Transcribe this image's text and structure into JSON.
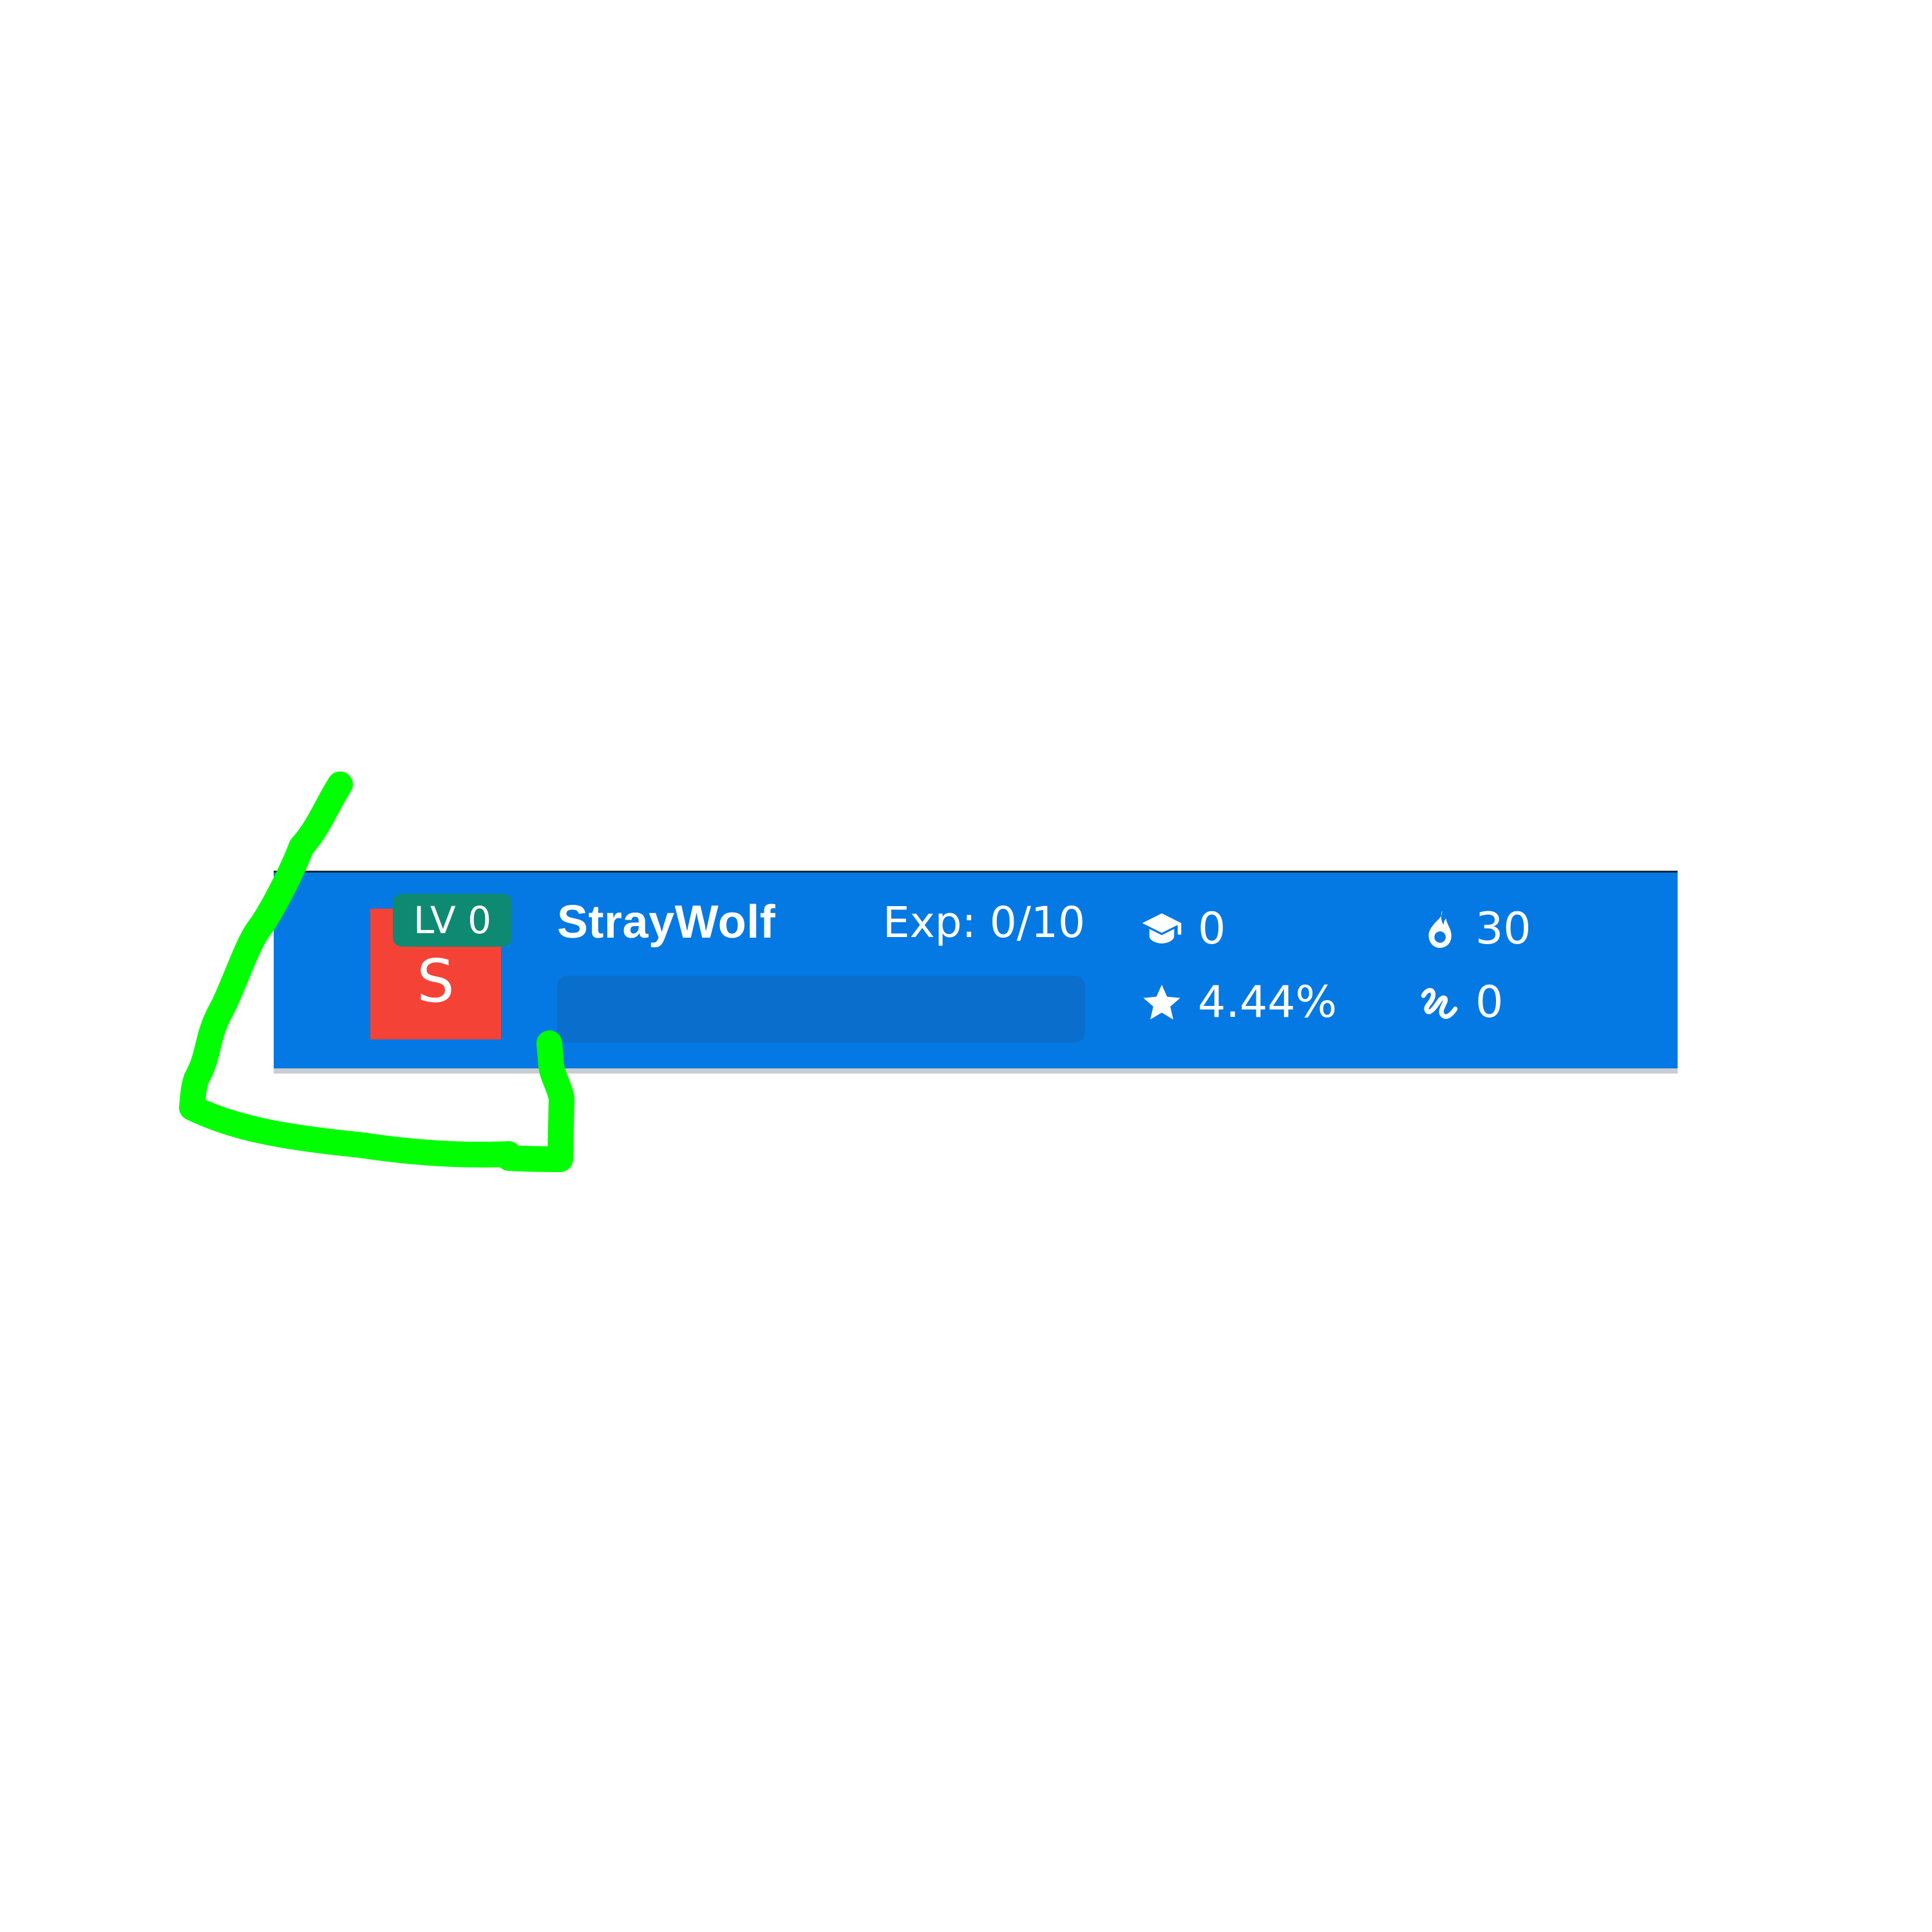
{
  "profile": {
    "avatar_letter": "S",
    "avatar_color": "#f44336",
    "level_label": "LV 0",
    "username": "StrayWolf",
    "exp_text": "Exp: 0/10",
    "exp_progress": 0
  },
  "stats": {
    "courses": {
      "icon": "graduation-cap-icon",
      "value": "0"
    },
    "rating": {
      "icon": "star-icon",
      "value": "4.44%"
    },
    "streak": {
      "icon": "fire-icon",
      "value": "30"
    },
    "other": {
      "icon": "squiggle-icon",
      "value": "0"
    }
  },
  "colors": {
    "bar_background": "#0479e3",
    "level_badge": "#0f8a72",
    "annotation_stroke": "#00ff00"
  }
}
